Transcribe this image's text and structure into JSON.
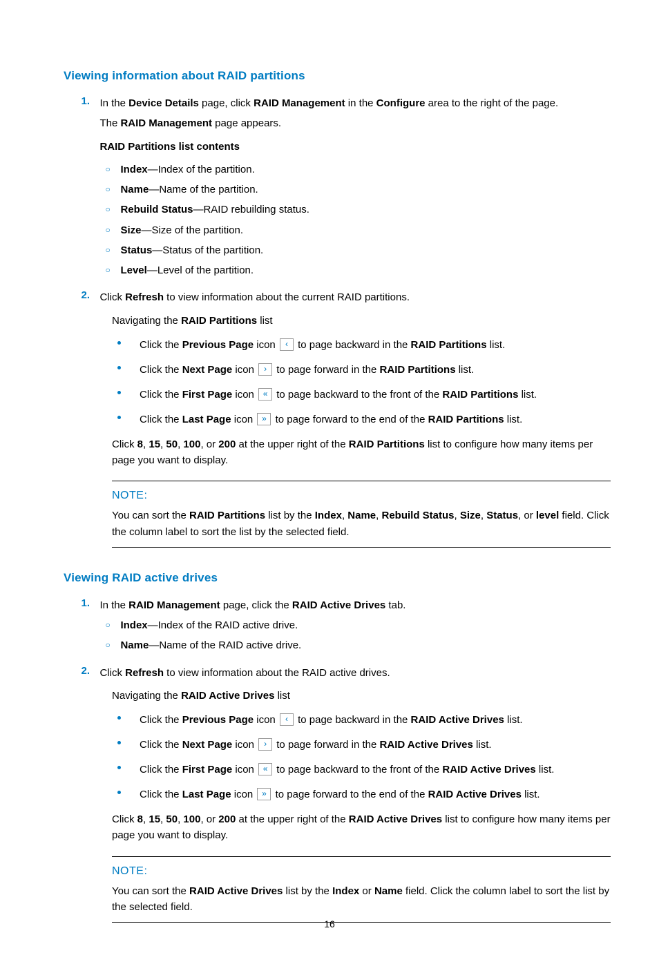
{
  "pageNumber": "16",
  "noteLabel": "NOTE:",
  "s1": {
    "heading": "Viewing information about RAID partitions",
    "step1": {
      "num": "1.",
      "line1_pre": "In the ",
      "line1_b1": "Device Details",
      "line1_mid1": " page, click ",
      "line1_b2": "RAID Management",
      "line1_mid2": " in the ",
      "line1_b3": "Configure",
      "line1_post": " area to the right of the page.",
      "line2_pre": "The ",
      "line2_b": "RAID Management",
      "line2_post": " page appears.",
      "listTitle": "RAID Partitions list contents",
      "items": [
        {
          "b": "Index",
          "t": "—Index of the partition."
        },
        {
          "b": "Name",
          "t": "—Name of the partition."
        },
        {
          "b": "Rebuild Status",
          "t": "—RAID rebuilding status."
        },
        {
          "b": "Size",
          "t": "—Size of the partition."
        },
        {
          "b": "Status",
          "t": "—Status of the partition."
        },
        {
          "b": "Level",
          "t": "—Level of the partition."
        }
      ]
    },
    "step2": {
      "num": "2.",
      "pre": "Click ",
      "b": "Refresh",
      "post": " to view information about the current RAID partitions."
    },
    "nav_pre": "Navigating the ",
    "nav_b": "RAID Partitions",
    "nav_post": " list",
    "nav": [
      {
        "pre": "Click the ",
        "b1": "Previous Page",
        "mid": " icon ",
        "glyph": "‹",
        "post1": " to page backward in the ",
        "b2": "RAID Partitions",
        "post2": " list."
      },
      {
        "pre": "Click the ",
        "b1": "Next Page",
        "mid": " icon ",
        "glyph": "›",
        "post1": " to page forward in the ",
        "b2": "RAID Partitions",
        "post2": " list."
      },
      {
        "pre": "Click the ",
        "b1": "First Page",
        "mid": " icon ",
        "glyph": "«",
        "post1": " to page backward to the front of the ",
        "b2": "RAID Partitions",
        "post2": " list."
      },
      {
        "pre": "Click the ",
        "b1": "Last Page",
        "mid": " icon ",
        "glyph": "»",
        "post1": " to page forward to the end of the ",
        "b2": "RAID Partitions",
        "post2": " list."
      }
    ],
    "sizes_pre": "Click ",
    "sizes_b1": "8",
    "sizes_c1": ", ",
    "sizes_b2": "15",
    "sizes_c2": ", ",
    "sizes_b3": "50",
    "sizes_c3": ", ",
    "sizes_b4": "100",
    "sizes_c4": ", or ",
    "sizes_b5": "200",
    "sizes_mid": " at the upper right of the ",
    "sizes_bt": "RAID Partitions",
    "sizes_post": " list to configure how many items per page you want to display.",
    "note_pre": "You can sort the ",
    "note_b1": "RAID Partitions",
    "note_mid1": " list by the ",
    "note_b2": "Index",
    "note_c2": ", ",
    "note_b3": "Name",
    "note_c3": ", ",
    "note_b4": "Rebuild Status",
    "note_c4": ", ",
    "note_b5": "Size",
    "note_c5": ", ",
    "note_b6": "Status",
    "note_c6": ", or ",
    "note_b7": "level",
    "note_post": " field. Click the column label to sort the list by the selected field."
  },
  "s2": {
    "heading": "Viewing RAID active drives",
    "step1": {
      "num": "1.",
      "pre": "In the ",
      "b1": "RAID Management",
      "mid": " page, click the ",
      "b2": "RAID Active Drives",
      "post": " tab.",
      "items": [
        {
          "b": "Index",
          "t": "—Index of the RAID active drive."
        },
        {
          "b": "Name",
          "t": "—Name of the RAID active drive."
        }
      ]
    },
    "step2": {
      "num": "2.",
      "pre": "Click ",
      "b": "Refresh",
      "post": " to view information about the RAID active drives."
    },
    "nav_pre": "Navigating the ",
    "nav_b": "RAID Active Drives",
    "nav_post": " list",
    "nav": [
      {
        "pre": "Click the ",
        "b1": "Previous Page",
        "mid": " icon ",
        "glyph": "‹",
        "post1": " to page backward in the ",
        "b2": "RAID Active Drives",
        "post2": " list."
      },
      {
        "pre": "Click the ",
        "b1": "Next Page",
        "mid": " icon ",
        "glyph": "›",
        "post1": " to page forward in the ",
        "b2": "RAID Active Drives",
        "post2": " list."
      },
      {
        "pre": "Click the ",
        "b1": "First Page",
        "mid": " icon ",
        "glyph": "«",
        "post1": " to page backward to the front of the ",
        "b2": "RAID Active Drives",
        "post2": " list."
      },
      {
        "pre": "Click the ",
        "b1": "Last Page",
        "mid": " icon ",
        "glyph": "»",
        "post1": " to page forward to the end of the ",
        "b2": "RAID Active Drives",
        "post2": " list."
      }
    ],
    "sizes_pre": "Click ",
    "sizes_b1": "8",
    "sizes_c1": ", ",
    "sizes_b2": "15",
    "sizes_c2": ", ",
    "sizes_b3": "50",
    "sizes_c3": ", ",
    "sizes_b4": "100",
    "sizes_c4": ", or ",
    "sizes_b5": "200",
    "sizes_mid": " at the upper right of the ",
    "sizes_bt": "RAID Active Drives",
    "sizes_post": " list to configure how many items per page you want to display.",
    "note_pre": "You can sort the ",
    "note_b1": "RAID Active Drives",
    "note_mid1": " list by the ",
    "note_b2": "Index",
    "note_c2": " or ",
    "note_b3": "Name",
    "note_post": " field. Click the column label to sort the list by the selected field."
  }
}
